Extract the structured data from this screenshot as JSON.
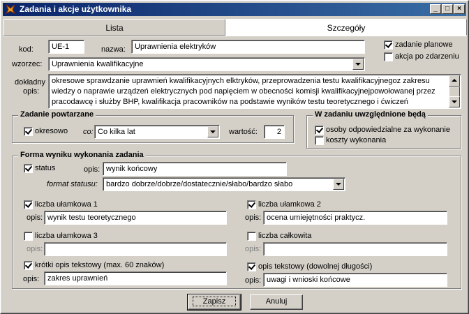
{
  "window": {
    "title": "Zadania i akcje użytkownika",
    "controls": [
      "_",
      "□",
      "×"
    ]
  },
  "tabs": [
    {
      "label": "Lista"
    },
    {
      "label": "Szczegóły"
    }
  ],
  "form": {
    "kod_label": "kod:",
    "kod_value": "UE-1",
    "nazwa_label": "nazwa:",
    "nazwa_value": "Uprawnienia elektryków",
    "wzorzec_label": "wzorzec:",
    "wzorzec_value": "Uprawnienia kwalifikacyjne",
    "opis_label_1": "dokładny",
    "opis_label_2": "opis:",
    "opis_lines": [
      "okresowe sprawdzanie uprawnień kwalifikacyjnych elktryków, przeprowadzenia testu kwalifikacyjnegoz zakresu",
      "wiedzy o naprawie urządzeń elektrycznych pod napięciem w obecności komisji kwalifikacyjnejpowołowanej przez",
      "pracodawcę i służby BHP, kwalifikacja pracowników na podstawie wyników testu teoretycznego i ćwiczeń"
    ],
    "zadanie_planowe": {
      "label": "zadanie planowe",
      "checked": true
    },
    "akcja_po_zdarzeniu": {
      "label": "akcja po zdarzeniu",
      "checked": false
    }
  },
  "repeat": {
    "title": "Zadanie powtarzane",
    "okresowo": {
      "label": "okresowo",
      "checked": true
    },
    "co_label": "co:",
    "co_value": "Co kilka lat",
    "wartosc_label": "wartość:",
    "wartosc_value": "2"
  },
  "included": {
    "title": "W zadaniu uwzględnione będą",
    "osoby": {
      "label": "osoby odpowiedzialne za wykonanie",
      "checked": true
    },
    "koszty": {
      "label": "koszty wykonania",
      "checked": false
    }
  },
  "result": {
    "title": "Forma wyniku wykonania zadania",
    "opis_label": "opis:",
    "status": {
      "label": "status",
      "checked": true,
      "opis": "wynik końcowy"
    },
    "format_label": "format statusu:",
    "format_value": "bardzo dobrze/dobrze/dostatecznie/słabo/bardzo słabo",
    "ulamkowa1": {
      "label": "liczba ułamkowa 1",
      "checked": true,
      "opis": "wynik testu teoretycznego"
    },
    "ulamkowa2": {
      "label": "liczba ułamkowa 2",
      "checked": true,
      "opis": "ocena umiejętności praktycz."
    },
    "ulamkowa3": {
      "label": "liczba ułamkowa 3",
      "checked": false,
      "opis": ""
    },
    "calkowita": {
      "label": "liczba całkowita",
      "checked": false,
      "opis": ""
    },
    "krotki": {
      "label": "krótki opis tekstowy (max. 60 znaków)",
      "checked": true,
      "opis": "zakres uprawnień"
    },
    "tekstowy": {
      "label": "opis tekstowy (dowolnej długości)",
      "checked": true,
      "opis": "uwagi i wnioski końcowe"
    }
  },
  "buttons": {
    "save": "Zapisz",
    "cancel": "Anuluj"
  }
}
